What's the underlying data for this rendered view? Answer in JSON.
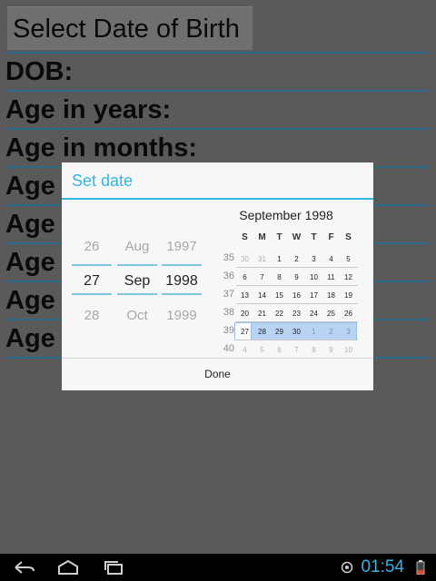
{
  "app": {
    "select_button": "Select Date of Birth",
    "fields": [
      "DOB:",
      "Age in years:",
      "Age in months:",
      "Age i",
      "Age i",
      "Age i",
      "Age i",
      "Age i"
    ]
  },
  "dialog": {
    "title": "Set date",
    "day": {
      "prev": "26",
      "current": "27",
      "next": "28"
    },
    "month": {
      "prev": "Aug",
      "current": "Sep",
      "next": "Oct"
    },
    "year": {
      "prev": "1997",
      "current": "1998",
      "next": "1999"
    },
    "calendar": {
      "month_label": "September 1998",
      "dow": [
        "S",
        "M",
        "T",
        "W",
        "T",
        "F",
        "S"
      ],
      "weeks": [
        {
          "num": "35",
          "days": [
            "30",
            "31",
            "1",
            "2",
            "3",
            "4",
            "5"
          ]
        },
        {
          "num": "36",
          "days": [
            "6",
            "7",
            "8",
            "9",
            "10",
            "11",
            "12"
          ]
        },
        {
          "num": "37",
          "days": [
            "13",
            "14",
            "15",
            "16",
            "17",
            "18",
            "19"
          ]
        },
        {
          "num": "38",
          "days": [
            "20",
            "21",
            "22",
            "23",
            "24",
            "25",
            "26"
          ]
        },
        {
          "num": "39",
          "days": [
            "27",
            "28",
            "29",
            "30",
            "1",
            "2",
            "3"
          ]
        },
        {
          "num": "40",
          "days": [
            "4",
            "5",
            "6",
            "7",
            "8",
            "9",
            "10"
          ]
        }
      ],
      "selected": "27"
    },
    "done_label": "Done"
  },
  "status": {
    "time": "01:54"
  },
  "colors": {
    "accent": "#33b5e5",
    "selection": "#b9d3f2",
    "divider": "#2d6d8a"
  }
}
